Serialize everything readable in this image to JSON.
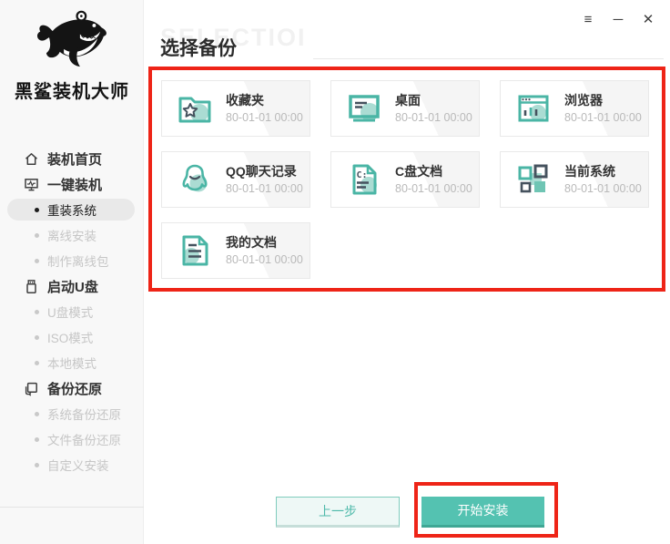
{
  "window": {
    "menu_glyph": "≡",
    "minimize_glyph": "─",
    "close_glyph": "✕"
  },
  "sidebar": {
    "logo_text": "黑鲨装机大师",
    "menu": [
      {
        "key": "install-home",
        "label": "装机首页",
        "type": "parent",
        "icon": "home-icon",
        "state": "normal"
      },
      {
        "key": "one-key-install",
        "label": "一键装机",
        "type": "parent",
        "icon": "monitor-icon",
        "state": "normal"
      },
      {
        "key": "reinstall-system",
        "label": "重装系统",
        "type": "sub",
        "state": "selected"
      },
      {
        "key": "offline-install",
        "label": "离线安装",
        "type": "sub",
        "state": "disabled"
      },
      {
        "key": "make-offline-pack",
        "label": "制作离线包",
        "type": "sub",
        "state": "disabled"
      },
      {
        "key": "boot-usb",
        "label": "启动U盘",
        "type": "parent",
        "icon": "usb-icon",
        "state": "normal"
      },
      {
        "key": "usb-mode",
        "label": "U盘模式",
        "type": "sub",
        "state": "disabled"
      },
      {
        "key": "iso-mode",
        "label": "ISO模式",
        "type": "sub",
        "state": "disabled"
      },
      {
        "key": "local-mode",
        "label": "本地模式",
        "type": "sub",
        "state": "disabled"
      },
      {
        "key": "backup-restore",
        "label": "备份还原",
        "type": "parent",
        "icon": "backup-icon",
        "state": "normal"
      },
      {
        "key": "system-backup-restore",
        "label": "系统备份还原",
        "type": "sub",
        "state": "disabled"
      },
      {
        "key": "file-backup-restore",
        "label": "文件备份还原",
        "type": "sub",
        "state": "disabled"
      },
      {
        "key": "custom-install",
        "label": "自定义安装",
        "type": "sub",
        "state": "disabled"
      }
    ],
    "footer_icons": [
      {
        "key": "ie-browser-icon"
      },
      {
        "key": "qq-icon"
      },
      {
        "key": "wechat-icon"
      }
    ]
  },
  "main": {
    "watermark": "SELECTIOI",
    "title": "选择备份",
    "cards": [
      {
        "key": "favorites",
        "name": "收藏夹",
        "date": "80-01-01 00:00",
        "icon": "favorites-folder-icon"
      },
      {
        "key": "desktop",
        "name": "桌面",
        "date": "80-01-01 00:00",
        "icon": "desktop-icon-card"
      },
      {
        "key": "browser",
        "name": "浏览器",
        "date": "80-01-01 00:00",
        "icon": "browser-icon"
      },
      {
        "key": "qq-chat",
        "name": "QQ聊天记录",
        "date": "80-01-01 00:00",
        "icon": "qq-chat-icon"
      },
      {
        "key": "c-drive-docs",
        "name": "C盘文档",
        "date": "80-01-01 00:00",
        "icon": "c-drive-doc-icon"
      },
      {
        "key": "current-system",
        "name": "当前系统",
        "date": "80-01-01 00:00",
        "icon": "current-system-icon"
      },
      {
        "key": "my-documents",
        "name": "我的文档",
        "date": "80-01-01 00:00",
        "icon": "my-documents-icon"
      }
    ],
    "buttons": {
      "prev": "上一步",
      "start": "开始安装"
    }
  },
  "colors": {
    "teal": "#4ab5a5",
    "teal_solid": "#54c2b1",
    "teal_light": "#abdcd3",
    "annotation_red": "#ee2417"
  }
}
